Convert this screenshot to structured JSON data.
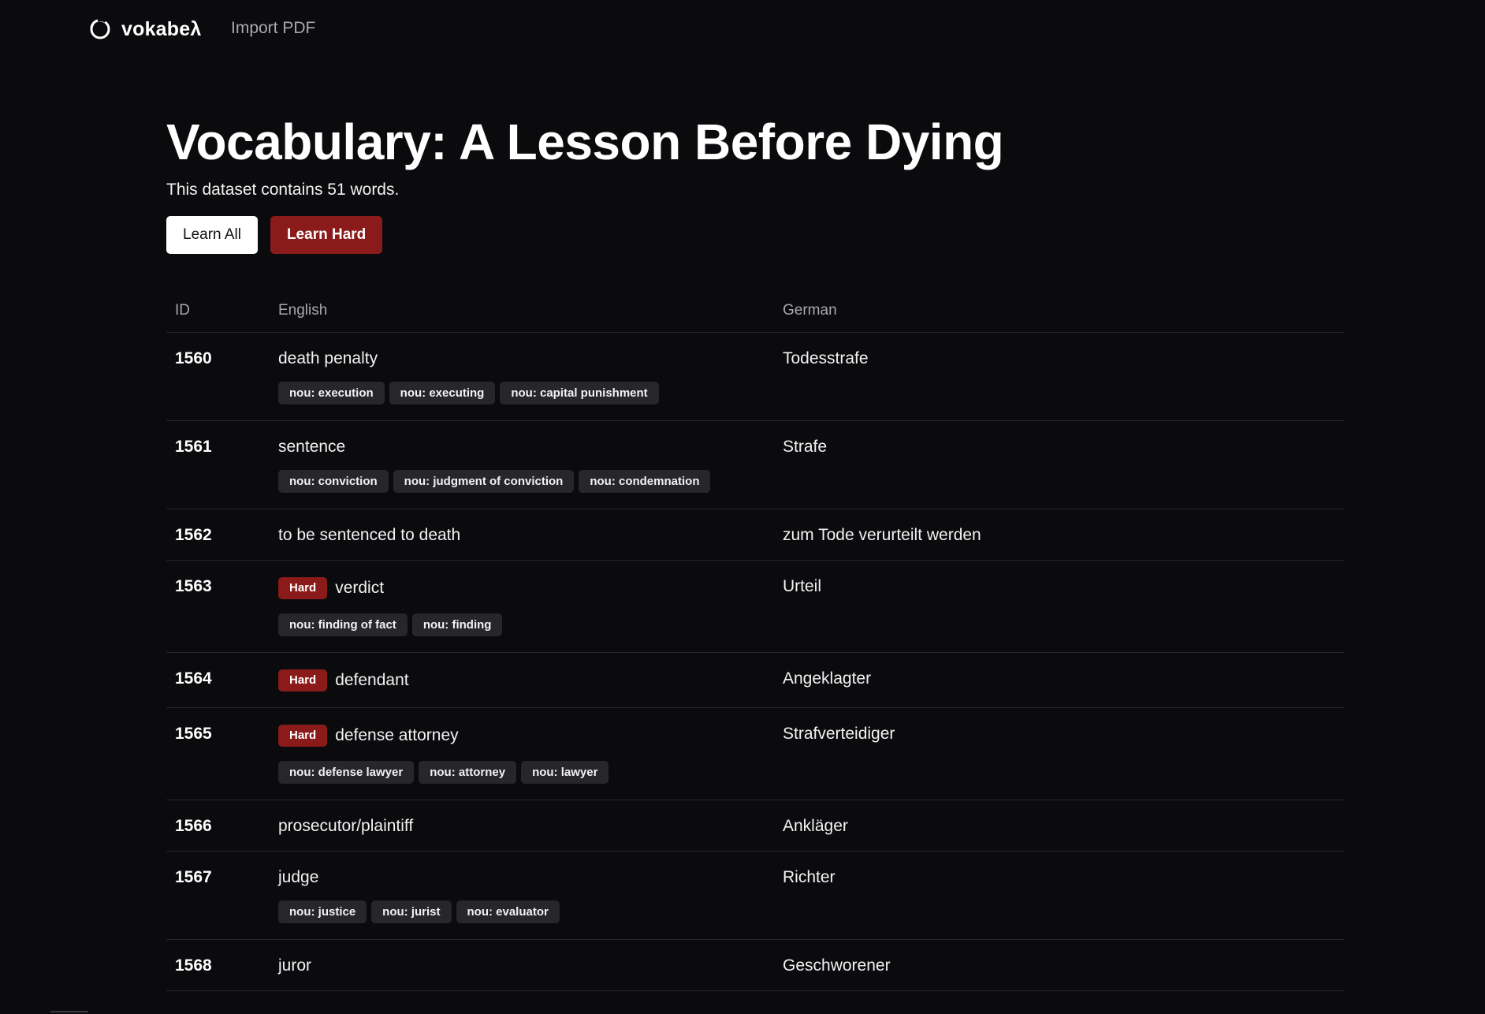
{
  "nav": {
    "brand": "vokabeλ",
    "logo_icon": "circle-logo-icon",
    "import_link": "Import PDF"
  },
  "header": {
    "title": "Vocabulary: A Lesson Before Dying",
    "subtitle": "This dataset contains 51 words.",
    "learn_all": "Learn All",
    "learn_hard": "Learn Hard"
  },
  "colors": {
    "background": "#0b0b0e",
    "accent": "#8b1a1a",
    "tag_bg": "#26262b"
  },
  "table": {
    "columns": [
      "ID",
      "English",
      "German"
    ],
    "hard_label": "Hard",
    "rows": [
      {
        "id": "1560",
        "english": "death penalty",
        "german": "Todesstrafe",
        "hard": false,
        "tags": [
          "nou: execution",
          "nou: executing",
          "nou: capital punishment"
        ]
      },
      {
        "id": "1561",
        "english": "sentence",
        "german": "Strafe",
        "hard": false,
        "tags": [
          "nou: conviction",
          "nou: judgment of conviction",
          "nou: condemnation"
        ]
      },
      {
        "id": "1562",
        "english": "to be sentenced to death",
        "german": "zum Tode verurteilt werden",
        "hard": false,
        "tags": []
      },
      {
        "id": "1563",
        "english": "verdict",
        "german": "Urteil",
        "hard": true,
        "tags": [
          "nou: finding of fact",
          "nou: finding"
        ]
      },
      {
        "id": "1564",
        "english": "defendant",
        "german": "Angeklagter",
        "hard": true,
        "tags": []
      },
      {
        "id": "1565",
        "english": "defense attorney",
        "german": "Strafverteidiger",
        "hard": true,
        "tags": [
          "nou: defense lawyer",
          "nou: attorney",
          "nou: lawyer"
        ]
      },
      {
        "id": "1566",
        "english": "prosecutor/plaintiff",
        "german": "Ankläger",
        "hard": false,
        "tags": []
      },
      {
        "id": "1567",
        "english": "judge",
        "german": "Richter",
        "hard": false,
        "tags": [
          "nou: justice",
          "nou: jurist",
          "nou: evaluator"
        ]
      },
      {
        "id": "1568",
        "english": "juror",
        "german": "Geschworener",
        "hard": false,
        "tags": []
      }
    ]
  }
}
